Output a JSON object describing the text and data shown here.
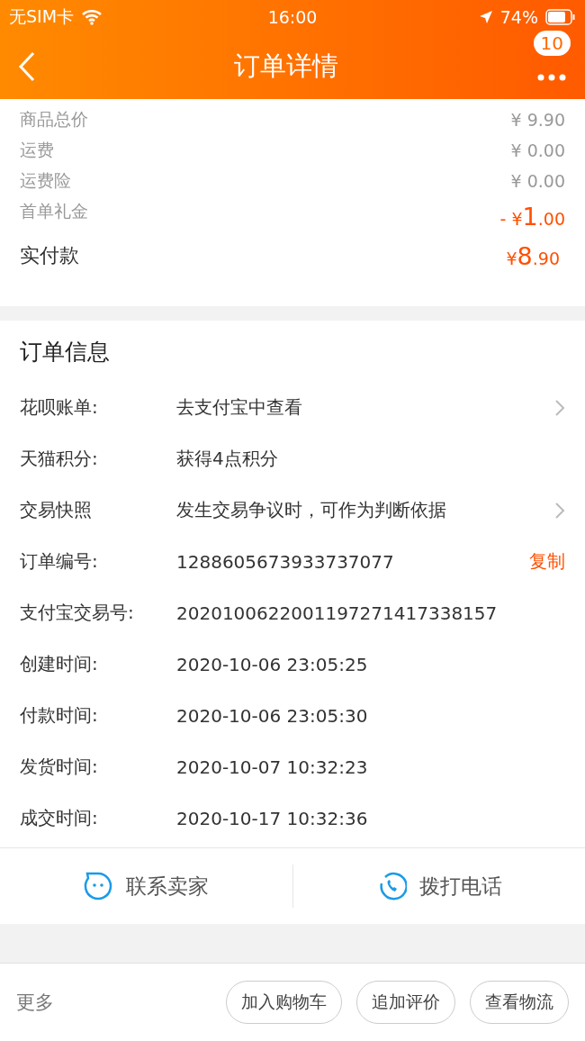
{
  "status_bar": {
    "carrier": "无SIM卡",
    "time": "16:00",
    "battery": "74%"
  },
  "nav": {
    "title": "订单详情",
    "badge": "10"
  },
  "price_rows": [
    {
      "kind": "plain",
      "label": "商品总价",
      "value": "¥ 9.90"
    },
    {
      "kind": "plain",
      "label": "运费",
      "value": "¥ 0.00"
    },
    {
      "kind": "plain",
      "label": "运费险",
      "value": "¥ 0.00"
    },
    {
      "kind": "discount",
      "label": "首单礼金",
      "currency": "- ¥",
      "integer": "1",
      "fraction": ".00"
    }
  ],
  "total": {
    "label": "实付款",
    "currency": "¥",
    "integer": "8",
    "fraction": ".90"
  },
  "order_info": {
    "title": "订单信息",
    "rows": [
      {
        "kind": "link",
        "label": "花呗账单:",
        "value": "去支付宝中查看"
      },
      {
        "kind": "plain",
        "label": "天猫积分:",
        "value": "获得4点积分"
      },
      {
        "kind": "link",
        "label": "交易快照",
        "value": "发生交易争议时，可作为判断依据"
      },
      {
        "kind": "action",
        "label": "订单编号:",
        "value": "1288605673933737077",
        "action": "复制"
      },
      {
        "kind": "plain",
        "label": "支付宝交易号:",
        "value": "2020100622001197271417338157"
      },
      {
        "kind": "plain",
        "label": "创建时间:",
        "value": "2020-10-06 23:05:25"
      },
      {
        "kind": "plain",
        "label": "付款时间:",
        "value": "2020-10-06 23:05:30"
      },
      {
        "kind": "plain",
        "label": "发货时间:",
        "value": "2020-10-07 10:32:23"
      },
      {
        "kind": "plain",
        "label": "成交时间:",
        "value": "2020-10-17 10:32:36"
      }
    ]
  },
  "contact": [
    {
      "kind": "chat",
      "label": "联系卖家"
    },
    {
      "kind": "phone",
      "label": "拨打电话"
    }
  ],
  "bottom_bar": {
    "more": "更多",
    "buttons": [
      "加入购物车",
      "追加评价",
      "查看物流"
    ]
  }
}
